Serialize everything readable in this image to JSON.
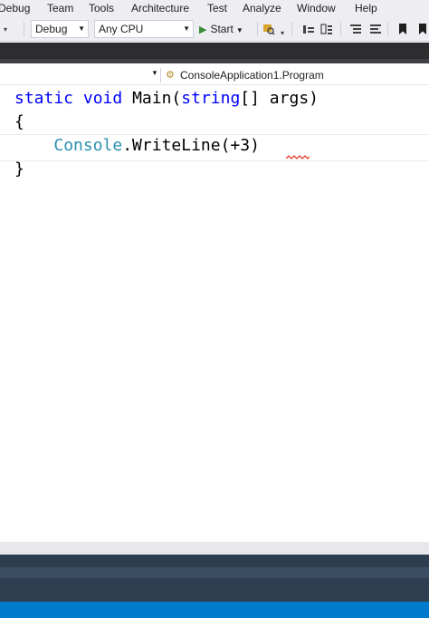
{
  "menu": {
    "items": [
      "Debug",
      "Team",
      "Tools",
      "Architecture",
      "Test",
      "Analyze",
      "Window",
      "Help"
    ]
  },
  "toolbar": {
    "configuration": "Debug",
    "platform": "Any CPU",
    "start_label": "Start"
  },
  "navigation": {
    "type_label": "ConsoleApplication1.Program"
  },
  "editor": {
    "line1": {
      "kw_static": "static",
      "kw_void": "void",
      "method": " Main(",
      "kw_string": "string",
      "rest": "[] args)"
    },
    "line2": "{",
    "line3": {
      "indent": "    ",
      "type": "Console",
      "rest": ".WriteLine(+3)"
    },
    "line4": "}"
  },
  "colors": {
    "keyword": "#0000ff",
    "type": "#2b91af",
    "status_bar": "#007acc",
    "error_squiggle": "#e51400"
  }
}
